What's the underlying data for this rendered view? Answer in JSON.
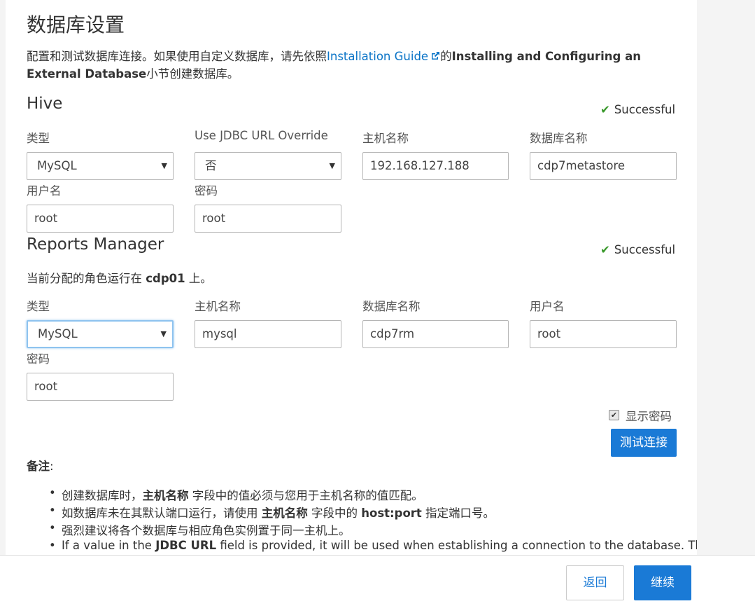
{
  "page": {
    "title": "数据库设置",
    "intro": {
      "pre": "配置和测试数据库连接。如果使用自定义数据库，请先依照",
      "link": "Installation Guide",
      "mid": "的",
      "bold": "Installing and Configuring an External Database",
      "post": "小节创建数据库。"
    }
  },
  "hive": {
    "title": "Hive",
    "status": "Successful",
    "labels": {
      "type": "类型",
      "jdbc": "Use JDBC URL Override",
      "host": "主机名称",
      "dbname": "数据库名称",
      "user": "用户名",
      "password": "密码"
    },
    "values": {
      "type": "MySQL",
      "jdbc": "否",
      "host": "192.168.127.188",
      "dbname": "cdp7metastore",
      "user": "root",
      "password": "root"
    }
  },
  "reports": {
    "title": "Reports Manager",
    "status": "Successful",
    "assigned_pre": "当前分配的角色运行在 ",
    "assigned_host": "cdp01",
    "assigned_post": " 上。",
    "labels": {
      "type": "类型",
      "host": "主机名称",
      "dbname": "数据库名称",
      "user": "用户名",
      "password": "密码"
    },
    "values": {
      "type": "MySQL",
      "host": "mysql",
      "dbname": "cdp7rm",
      "user": "root",
      "password": "root"
    }
  },
  "actions": {
    "show_password": "显示密码",
    "test_connection": "测试连接"
  },
  "notes": {
    "title": "备注",
    "colon": ":",
    "items": [
      {
        "pre": "创建数据库时，",
        "bold": "主机名称",
        "post": " 字段中的值必须与您用于主机名称的值匹配。"
      },
      {
        "pre": "如数据库未在其默认端口运行，请使用 ",
        "bold": "主机名称",
        "mid": " 字段中的 ",
        "bold2": "host:port",
        "post": " 指定端口号。"
      },
      {
        "pre": "强烈建议将各个数据库与相应角色实例置于同一主机上。"
      },
      {
        "pre": "If a value in the ",
        "bold": "JDBC URL",
        "post": " field is provided, it will be used when establishing a connection to the database. This"
      }
    ]
  },
  "footer": {
    "back": "返回",
    "continue": "继续"
  },
  "colors": {
    "accent": "#1a7ad6",
    "link": "#0a74c7",
    "success": "#3c9a2e"
  },
  "icons": [
    "external-link-icon",
    "checkmark-icon",
    "dropdown-arrow-icon",
    "checkbox-checked-icon"
  ]
}
